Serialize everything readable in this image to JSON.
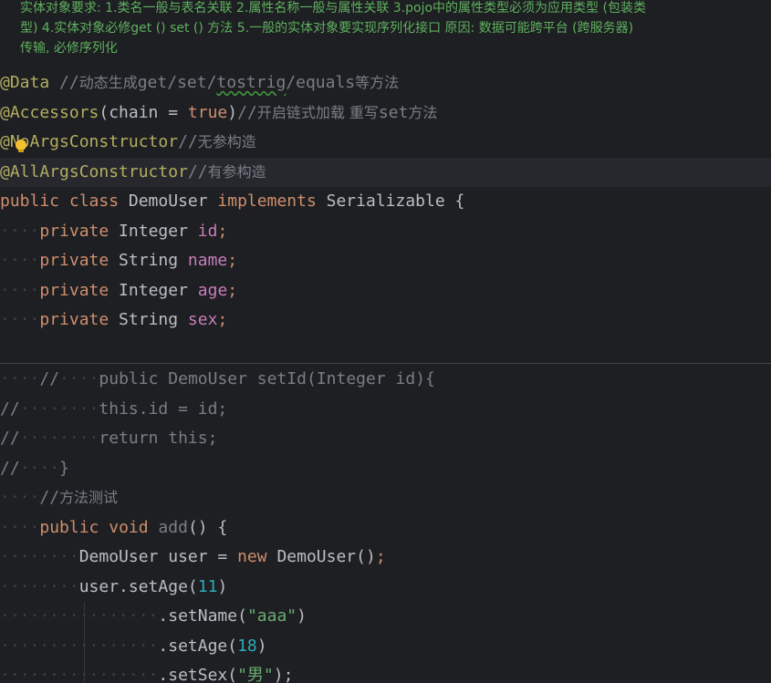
{
  "doc_comment": [
    "实体对象要求:  1.类名一般与表名关联 2.属性名称一般与属性关联 3.pojo中的属性类型必须为应用类型 (包装类",
    "型)  4.实体对象必修get () set () 方法 5.一般的实体对象要实现序列化接口 原因: 数据可能跨平台 (跨服务器)",
    "传输, 必修序列化"
  ],
  "code": {
    "l1": {
      "ann": "@Data",
      "c1": " //",
      "c2": "动态生成",
      "c3": "get/set/",
      "c4": "tostrig",
      "c5": "/equals",
      "c6": "等方法"
    },
    "l2": {
      "ann": "@Accessors",
      "p1": "(chain = ",
      "kw": "true",
      "p2": ")",
      "c1": "//",
      "c2": "开启链式加载 重写",
      "c3": "set",
      "c4": "方法"
    },
    "l3": {
      "ann": "@NoArgsConstructor",
      "c1": "//",
      "c2": "无参构造"
    },
    "l4": {
      "ann": "@AllArgsConstructor",
      "c1": "//",
      "c2": "有参构造"
    },
    "l5": {
      "kw1": "public class",
      "name": " DemoUser ",
      "kw2": "implements",
      "iface": " Serializable {"
    },
    "l6": {
      "ws": "····",
      "kw": "private",
      "type": " Integer ",
      "field": "id",
      "end": ";"
    },
    "l7": {
      "ws": "····",
      "kw": "private",
      "type": " String ",
      "field": "name",
      "end": ";"
    },
    "l8": {
      "ws": "····",
      "kw": "private",
      "type": " Integer ",
      "field": "age",
      "end": ";"
    },
    "l9": {
      "ws": "····",
      "kw": "private",
      "type": " String ",
      "field": "sex",
      "end": ";"
    },
    "l10": {
      "ws1": "····",
      "text": "//",
      "ws2": "····",
      "rest": "public DemoUser setId(Integer id){"
    },
    "l11": {
      "text": "//",
      "ws": "········",
      "rest": "this.id = id;"
    },
    "l12": {
      "text": "//",
      "ws": "········",
      "rest": "return this;"
    },
    "l13": {
      "text": "//",
      "ws": "····",
      "rest": "}"
    },
    "l14": {
      "ws": "····",
      "c1": "//",
      "c2": "方法测试"
    },
    "l15": {
      "ws": "····",
      "kw1": "public",
      "sp": " ",
      "kw2": "void",
      "fn": " add",
      "rest": "() {"
    },
    "l16": {
      "ws": "········",
      "type": "DemoUser user = ",
      "kw": "new",
      "rest": " DemoUser()",
      "end": ";"
    },
    "l17": {
      "ws": "········",
      "text": "user.setAge(",
      "num": "11",
      "end": ")"
    },
    "l18": {
      "ws": "················",
      "text": ".setName(",
      "str": "\"aaa\"",
      "end": ")"
    },
    "l19": {
      "ws": "················",
      "text": ".setAge(",
      "num": "18",
      "end": ")"
    },
    "l20": {
      "ws": "················",
      "text": ".setSex(",
      "str": "\"男\"",
      "end": ");"
    }
  }
}
